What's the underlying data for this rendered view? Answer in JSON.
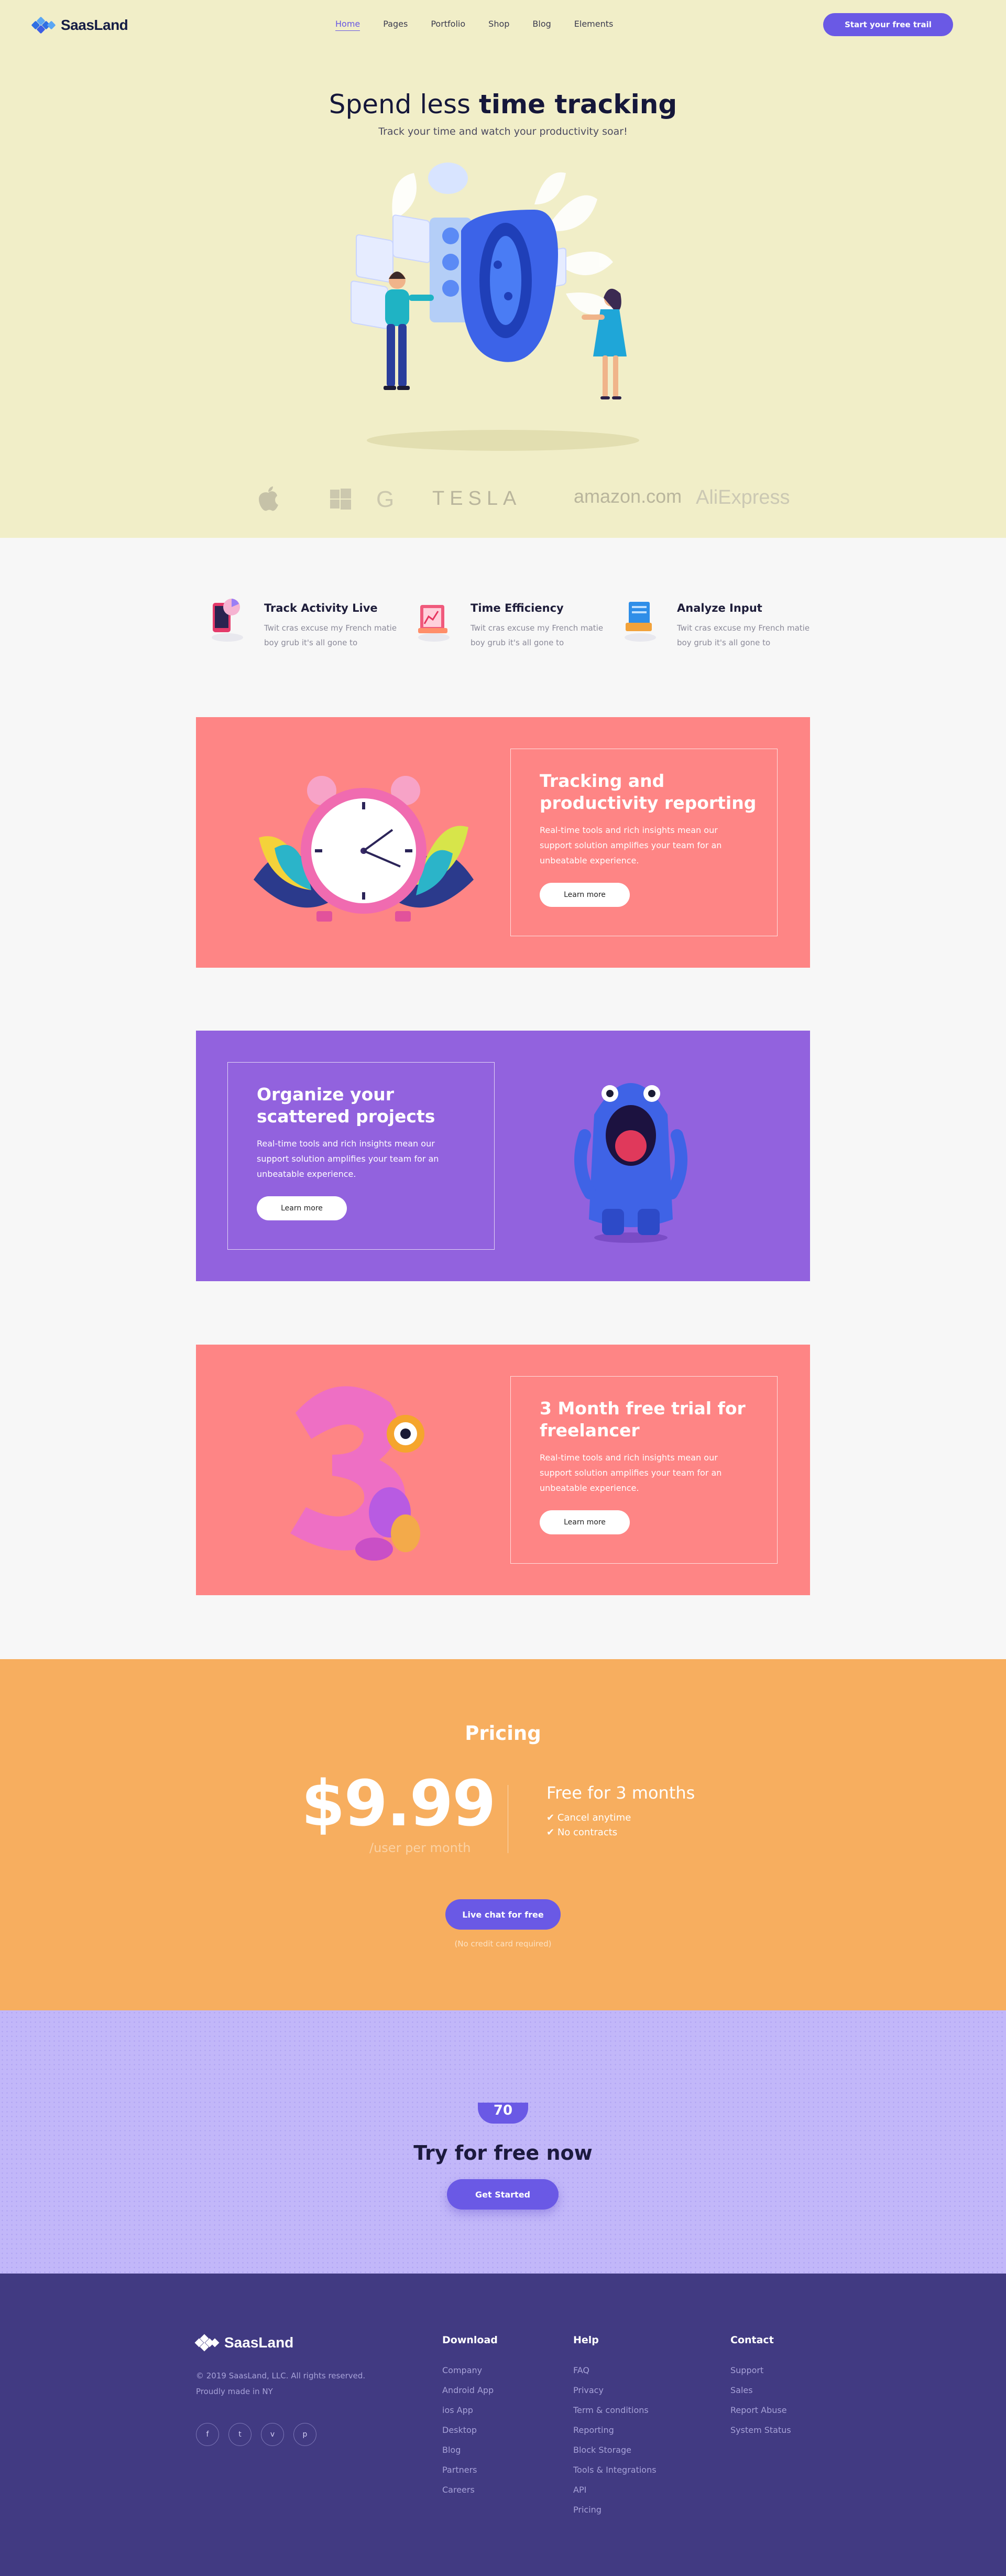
{
  "brand": {
    "name": "SaasLand",
    "colors": {
      "primary": "#6a59e5",
      "hero_bg": "#f1eec8",
      "coral": "#fe8585",
      "violet": "#9262de",
      "orange": "#f7ae5f",
      "lavender": "#c2b7f9",
      "footer_bg": "#413a82"
    }
  },
  "nav": {
    "items": [
      {
        "label": "Home",
        "active": true
      },
      {
        "label": "Pages",
        "active": false
      },
      {
        "label": "Portfolio",
        "active": false
      },
      {
        "label": "Shop",
        "active": false
      },
      {
        "label": "Blog",
        "active": false
      },
      {
        "label": "Elements",
        "active": false
      }
    ],
    "cta": "Start your free trail"
  },
  "hero": {
    "title_light": "Spend less ",
    "title_bold": "time tracking",
    "subtitle": "Track your time and watch your productivity soar!",
    "brands": [
      "apple-logo",
      "windows-logo",
      "google-logo",
      "TESLA",
      "amazon.com",
      "AliExpress"
    ]
  },
  "features": [
    {
      "title": "Track Activity Live",
      "text": "Twit cras excuse my French matie boy grub it's all gone to",
      "icon": "phone-chart-icon"
    },
    {
      "title": "Time Efficiency",
      "text": "Twit cras excuse my French matie boy grub it's all gone to",
      "icon": "clipboard-graph-icon"
    },
    {
      "title": "Analyze Input",
      "text": "Twit cras excuse my French matie boy grub it's all gone to",
      "icon": "document-stack-icon"
    }
  ],
  "cards": [
    {
      "title": "Tracking and productivity reporting",
      "text": "Real-time tools and rich insights mean our support solution amplifies your team for an unbeatable experience.",
      "button": "Learn more",
      "image": "alarm-clock-illustration"
    },
    {
      "title": "Organize your scattered projects",
      "text": "Real-time tools and rich insights mean our support solution amplifies your team for an unbeatable experience.",
      "button": "Learn more",
      "image": "blue-monster-illustration"
    },
    {
      "title": "3 Month free trial for freelancer",
      "text": "Real-time tools and rich insights mean our support solution amplifies your team for an unbeatable experience.",
      "button": "Learn more",
      "image": "pink-three-monster-illustration"
    }
  ],
  "pricing": {
    "title": "Pricing",
    "price": "$9.99",
    "unit": "/user per month",
    "free_title": "Free for 3 months",
    "checks": [
      "Cancel anytime",
      "No contracts"
    ],
    "button": "Live chat for free",
    "note": "(No credit card required)"
  },
  "tryfree": {
    "badge": "70",
    "title": "Try for free now",
    "button": "Get Started"
  },
  "footer": {
    "copyright": "© 2019 SaasLand, LLC. All rights reserved.",
    "made": "Proudly made in NY",
    "socials": [
      "f",
      "t",
      "v",
      "p"
    ],
    "columns": [
      {
        "title": "Download",
        "links": [
          "Company",
          "Android App",
          "ios App",
          "Desktop",
          "Blog",
          "Partners",
          "Careers"
        ]
      },
      {
        "title": "Help",
        "links": [
          "FAQ",
          "Privacy",
          "Term & conditions",
          "Reporting",
          "Block Storage",
          "Tools & Integrations",
          "API",
          "Pricing"
        ]
      },
      {
        "title": "Contact",
        "links": [
          "Support",
          "Sales",
          "Report Abuse",
          "System Status"
        ]
      }
    ]
  }
}
